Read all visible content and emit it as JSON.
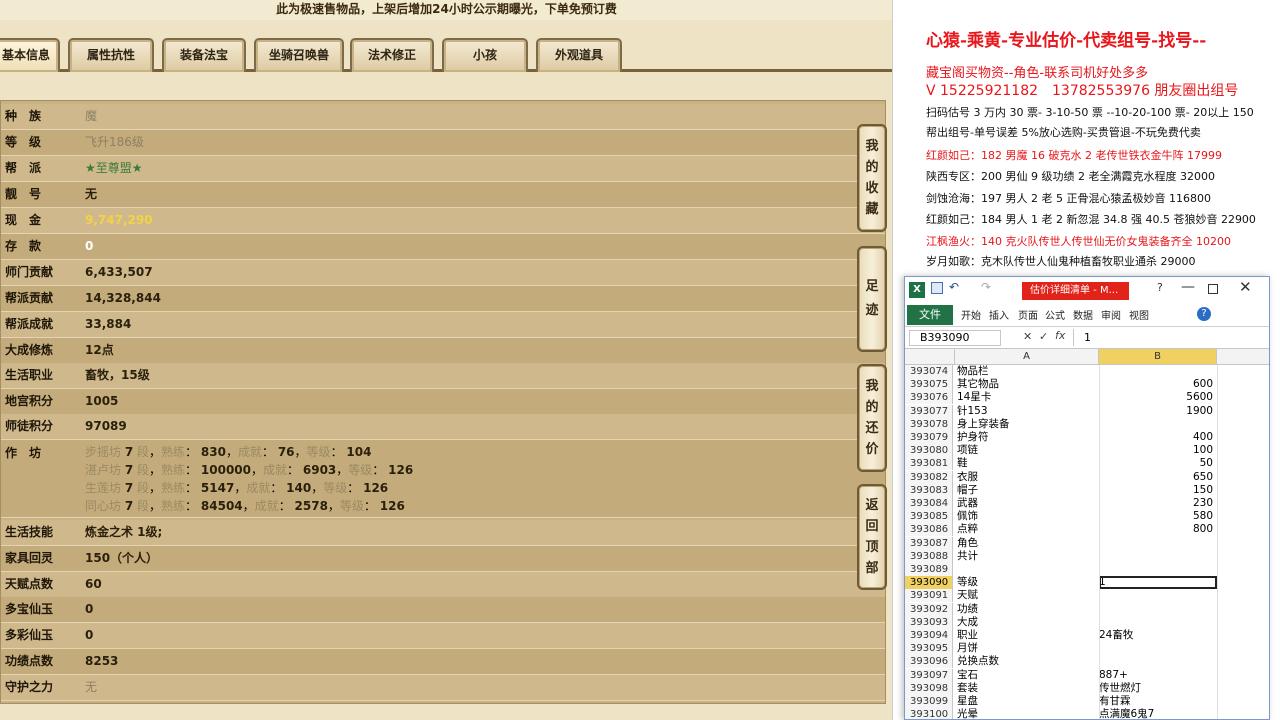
{
  "game": {
    "notice": "此为极速售物品，上架后增加24小时公示期曝光，下单免预订费",
    "tabs": [
      "基本信息",
      "属性抗性",
      "装备法宝",
      "坐骑召唤兽",
      "法术修正",
      "小孩",
      "外观道具"
    ],
    "rows": [
      {
        "label": "种　族",
        "value": "魔",
        "style": "gray"
      },
      {
        "label": "等　级",
        "value": "飞升186级",
        "style": "gray"
      },
      {
        "label": "帮　派",
        "value": "★至尊盟★",
        "style": "green"
      },
      {
        "label": "靓　号",
        "value": "无",
        "style": "normal"
      },
      {
        "label": "现　金",
        "value": "9,747,290",
        "style": "yellow"
      },
      {
        "label": "存　款",
        "value": "0",
        "style": "white"
      },
      {
        "label": "师门贡献",
        "value": "6,433,507",
        "style": "normal"
      },
      {
        "label": "帮派贡献",
        "value": "14,328,844",
        "style": "normal"
      },
      {
        "label": "帮派成就",
        "value": "33,884",
        "style": "normal"
      },
      {
        "label": "大成修炼",
        "value": "12点",
        "style": "normal"
      },
      {
        "label": "生活职业",
        "value": "畜牧，15级",
        "style": "normal"
      },
      {
        "label": "地宫积分",
        "value": "1005",
        "style": "normal"
      },
      {
        "label": "师徒积分",
        "value": "97089",
        "style": "normal"
      }
    ],
    "workshop_label": "作　坊",
    "workshops": [
      {
        "name": "步摇坊",
        "level": "7",
        "skill": "830",
        "achieve": "76",
        "grade": "104"
      },
      {
        "name": "湛卢坊",
        "level": "7",
        "skill": "100000",
        "achieve": "6903",
        "grade": "126"
      },
      {
        "name": "生莲坊",
        "level": "7",
        "skill": "5147",
        "achieve": "140",
        "grade": "126"
      },
      {
        "name": "同心坊",
        "level": "7",
        "skill": "84504",
        "achieve": "2578",
        "grade": "126"
      }
    ],
    "workshop_words": {
      "duan": "段",
      "skill": "熟练",
      "achieve": "成就",
      "grade": "等级"
    },
    "rows2": [
      {
        "label": "生活技能",
        "value": "炼金之术 1级;",
        "style": "normal"
      },
      {
        "label": "家具回灵",
        "value": "150（个人）",
        "style": "normal"
      },
      {
        "label": "天赋点数",
        "value": "60",
        "style": "normal"
      },
      {
        "label": "多宝仙玉",
        "value": "0",
        "style": "normal"
      },
      {
        "label": "多彩仙玉",
        "value": "0",
        "style": "normal"
      },
      {
        "label": "功绩点数",
        "value": "8253",
        "style": "normal"
      },
      {
        "label": "守护之力",
        "value": "无",
        "style": "gray"
      }
    ],
    "side_buttons": [
      "我的收藏",
      "足迹",
      "我的还价",
      "返回顶部"
    ]
  },
  "doc": {
    "title": "心猿-乘黄-专业估价-代卖组号-找号--",
    "lines": [
      {
        "text": "藏宝阁买物资--角色-联系司机好处多多",
        "color": "#e8161b"
      },
      {
        "text": "V 15225921182　13782553976 朋友圈出组号",
        "color": "#e8161b"
      },
      {
        "text": "扫码估号 3 万内 30 票- 3-10-50 票 --10-20-100 票- 20以上 150",
        "color": "#111111"
      },
      {
        "text": "帮出组号-单号误差 5%放心选购-买贵管退-不玩免费代卖",
        "color": "#111111"
      },
      {
        "text": "红颜如己：182 男魔 16 破克水 2 老传世铁衣金牛阵 17999",
        "color": "#e8161b"
      },
      {
        "text": "陕西专区：200 男仙 9 级功绩 2 老全满霞克水程度 32000",
        "color": "#111111"
      },
      {
        "text": "剑蚀沧海：197 男人 2 老 5 正骨混心猿孟极妙音 116800",
        "color": "#111111"
      },
      {
        "text": "红颜如己：184 男人 1 老 2 新忽混 34.8 强 40.5 苍狼妙音 22900",
        "color": "#111111"
      },
      {
        "text": "江枫渔火：140 克火队传世人传世仙无价女鬼装备齐全 10200",
        "color": "#e8161b"
      },
      {
        "text": "岁月如歌：克木队传世人仙鬼种植畜牧职业通杀 29000",
        "color": "#111111"
      }
    ]
  },
  "excel": {
    "title": "估价详细清单 - M...",
    "menu": [
      "文件",
      "开始",
      "插入",
      "页面",
      "公式",
      "数据",
      "审阅",
      "视图"
    ],
    "cell_ref": "B393090",
    "formula_value": "1",
    "fx": "fx",
    "col_a": "A",
    "col_b": "B",
    "rows": [
      {
        "n": "393074",
        "a": "物品栏",
        "b": "",
        "num": false
      },
      {
        "n": "393075",
        "a": "其它物品",
        "b": "600",
        "num": true
      },
      {
        "n": "393076",
        "a": "14星卡",
        "b": "5600",
        "num": true
      },
      {
        "n": "393077",
        "a": "针153",
        "b": "1900",
        "num": true
      },
      {
        "n": "393078",
        "a": "身上穿装备",
        "b": "",
        "num": false
      },
      {
        "n": "393079",
        "a": "护身符",
        "b": "400",
        "num": true
      },
      {
        "n": "393080",
        "a": "项链",
        "b": "100",
        "num": true
      },
      {
        "n": "393081",
        "a": "鞋",
        "b": "50",
        "num": true
      },
      {
        "n": "393082",
        "a": "衣服",
        "b": "650",
        "num": true
      },
      {
        "n": "393083",
        "a": "帽子",
        "b": "150",
        "num": true
      },
      {
        "n": "393084",
        "a": "武器",
        "b": "230",
        "num": true
      },
      {
        "n": "393085",
        "a": "佩饰",
        "b": "580",
        "num": true
      },
      {
        "n": "393086",
        "a": "点粹",
        "b": "800",
        "num": true
      },
      {
        "n": "393087",
        "a": "角色",
        "b": "",
        "num": false
      },
      {
        "n": "393088",
        "a": "共计",
        "b": "",
        "num": false
      },
      {
        "n": "393089",
        "a": "",
        "b": "",
        "num": false
      },
      {
        "n": "393090",
        "a": "等级",
        "b": "1",
        "num": false,
        "sel": true
      },
      {
        "n": "393091",
        "a": "天赋",
        "b": "",
        "num": false
      },
      {
        "n": "393092",
        "a": "功绩",
        "b": "",
        "num": false
      },
      {
        "n": "393093",
        "a": "大成",
        "b": "",
        "num": false
      },
      {
        "n": "393094",
        "a": "职业",
        "b": "24畜牧",
        "num": false
      },
      {
        "n": "393095",
        "a": "月饼",
        "b": "",
        "num": false
      },
      {
        "n": "393096",
        "a": "兑换点数",
        "b": "",
        "num": false
      },
      {
        "n": "393097",
        "a": "宝石",
        "b": "887+",
        "num": false
      },
      {
        "n": "393098",
        "a": "套装",
        "b": "传世燃灯",
        "num": false
      },
      {
        "n": "393099",
        "a": "星盘",
        "b": "有甘霖",
        "num": false
      },
      {
        "n": "393100",
        "a": "光晕",
        "b": "点满魔6鬼7",
        "num": false
      }
    ]
  }
}
